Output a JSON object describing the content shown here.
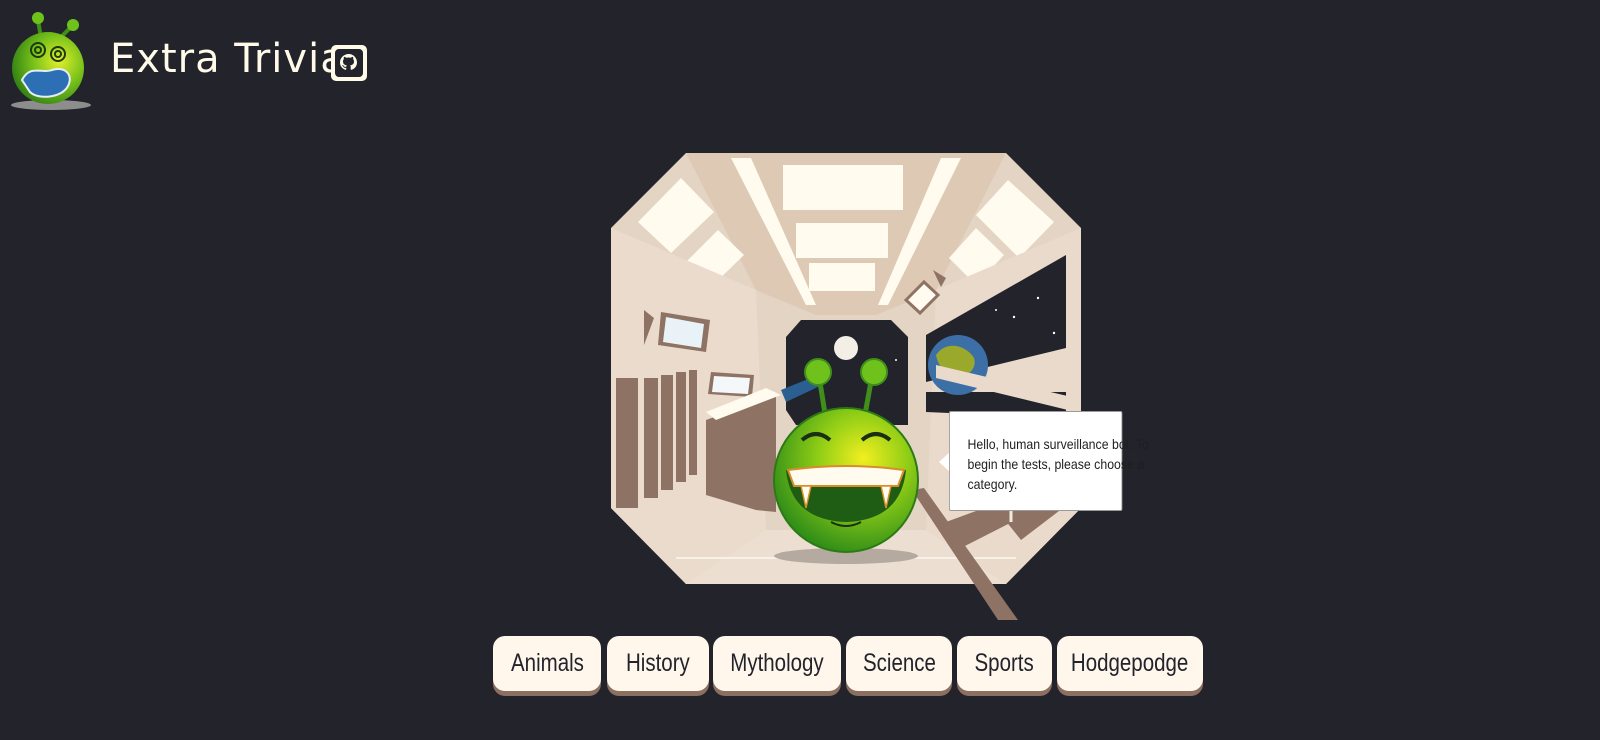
{
  "header": {
    "title": "Extra Trivia",
    "logo_icon": "alien-logo-icon",
    "github_icon": "github-icon"
  },
  "scene": {
    "illustration": "spaceship-interior",
    "alien_icon": "green-alien-icon",
    "speech": "Hello, human surveillance bot. To begin the tests, please choose a category."
  },
  "categories": [
    {
      "label": "Animals"
    },
    {
      "label": "History"
    },
    {
      "label": "Mythology"
    },
    {
      "label": "Science"
    },
    {
      "label": "Sports"
    },
    {
      "label": "Hodgepodge"
    }
  ],
  "colors": {
    "background": "#22232b",
    "button_bg": "#fff7ec",
    "button_shadow": "#8b6f61",
    "title": "#fffbe8",
    "alien_green": "#6fc21c"
  }
}
